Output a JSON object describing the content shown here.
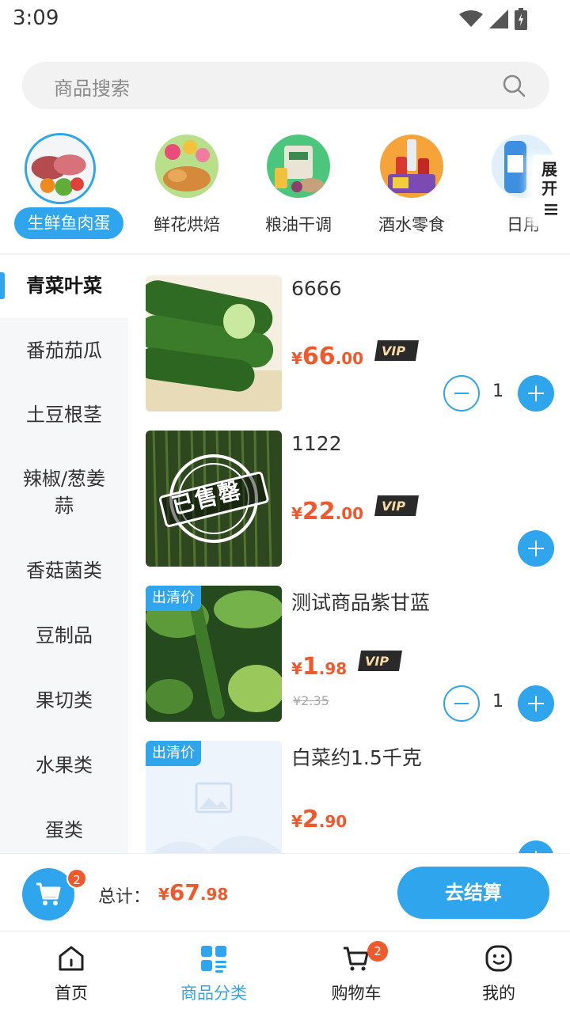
{
  "status_bar": {
    "time": "3:09"
  },
  "search": {
    "placeholder": "商品搜索"
  },
  "categories": [
    {
      "label": "生鲜鱼肉蛋",
      "active": true
    },
    {
      "label": "鲜花烘焙",
      "active": false
    },
    {
      "label": "粮油干调",
      "active": false
    },
    {
      "label": "酒水零食",
      "active": false
    },
    {
      "label": "日用",
      "active": false
    }
  ],
  "expand_label": "展开",
  "sidebar": {
    "items": [
      {
        "label": "青菜叶菜",
        "active": true
      },
      {
        "label": "番茄茄瓜",
        "active": false
      },
      {
        "label": "土豆根茎",
        "active": false
      },
      {
        "label": "辣椒/葱姜蒜",
        "active": false
      },
      {
        "label": "香菇菌类",
        "active": false
      },
      {
        "label": "豆制品",
        "active": false
      },
      {
        "label": "果切类",
        "active": false
      },
      {
        "label": "水果类",
        "active": false
      },
      {
        "label": "蛋类",
        "active": false
      }
    ]
  },
  "products": [
    {
      "name": "6666",
      "price_currency": "¥",
      "price_int": "66",
      "price_dec": ".00",
      "vip_label": "VIP",
      "quantity": "1",
      "sold_out_stamp": "",
      "tag": ""
    },
    {
      "name": "1122",
      "price_currency": "¥",
      "price_int": "22",
      "price_dec": ".00",
      "vip_label": "VIP",
      "quantity": "",
      "sold_out_stamp": "已售罄",
      "tag": ""
    },
    {
      "name": "测试商品紫甘蓝",
      "price_currency": "¥",
      "price_int": "1",
      "price_dec": ".98",
      "vip_label": "VIP",
      "old_price": "¥2.35",
      "quantity": "1",
      "sold_out_stamp": "",
      "tag": "出清价"
    },
    {
      "name": "白菜约1.5千克",
      "price_currency": "¥",
      "price_int": "2",
      "price_dec": ".90",
      "vip_label": "",
      "quantity": "",
      "sold_out_stamp": "",
      "tag": "出清价"
    }
  ],
  "cart": {
    "badge": "2",
    "total_label": "总计：",
    "total_currency": "¥",
    "total_int": "67",
    "total_dec": ".98",
    "checkout_label": "去结算"
  },
  "bottom_nav": [
    {
      "label": "首页",
      "icon": "home-icon",
      "active": false
    },
    {
      "label": "商品分类",
      "icon": "category-icon",
      "active": true
    },
    {
      "label": "购物车",
      "icon": "cart-icon",
      "active": false,
      "badge": "2"
    },
    {
      "label": "我的",
      "icon": "profile-icon",
      "active": false
    }
  ],
  "colors": {
    "accent": "#2ea5ec",
    "price": "#f0592b",
    "badge": "#f0592b"
  }
}
